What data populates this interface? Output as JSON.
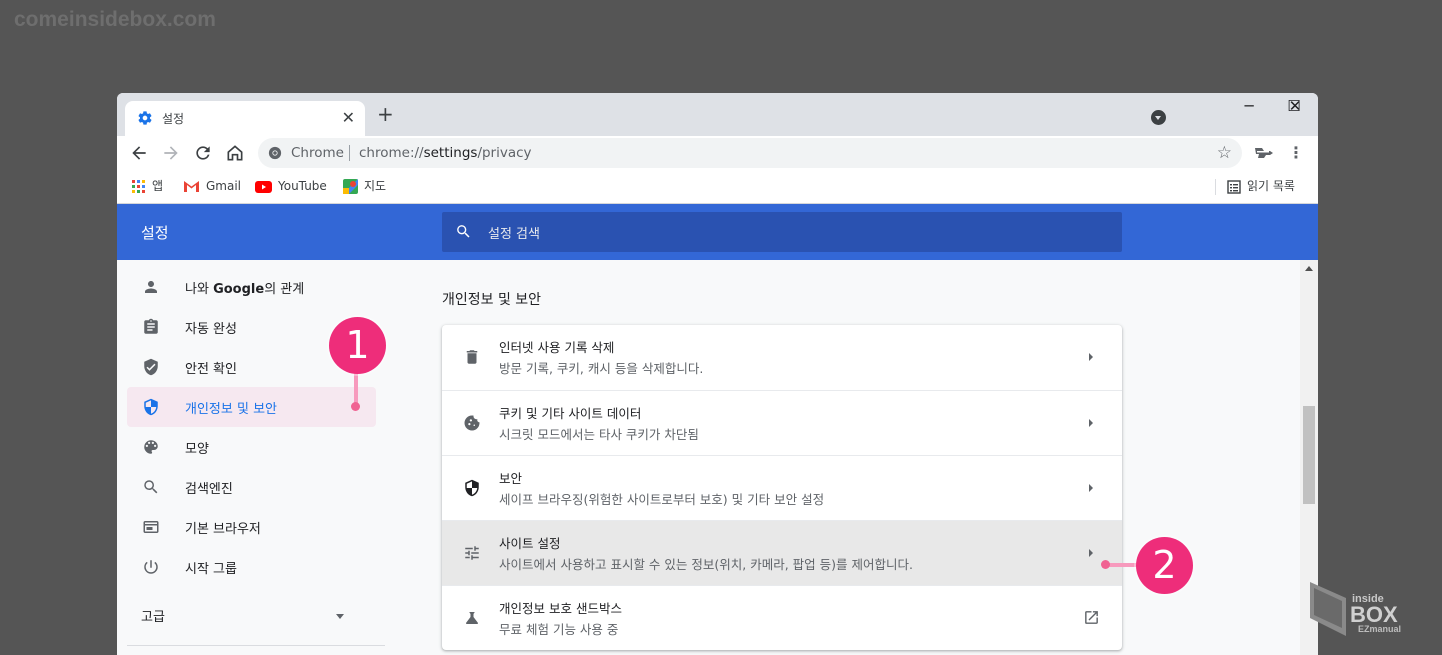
{
  "watermark": "comeinsidebox.com",
  "tab": {
    "title": "설정",
    "close": "✕"
  },
  "new_tab": "+",
  "window_controls": {
    "minimize": "─",
    "maximize": "☐",
    "close": "✕"
  },
  "omnibox": {
    "site": "Chrome",
    "url_prefix": "chrome://",
    "url_bold": "settings",
    "url_suffix": "/privacy"
  },
  "bookmarks": {
    "apps": "앱",
    "gmail": "Gmail",
    "youtube": "YouTube",
    "maps": "지도",
    "reading_list": "읽기 목록"
  },
  "settings": {
    "title": "설정",
    "search_placeholder": "설정 검색"
  },
  "sidebar": {
    "items": [
      {
        "label_pre": "나와 ",
        "label_bold": "Google",
        "label_post": "의 관계",
        "icon": "person-icon"
      },
      {
        "label": "자동 완성",
        "icon": "clipboard-icon"
      },
      {
        "label": "안전 확인",
        "icon": "shield-check-icon"
      },
      {
        "label": "개인정보 및 보안",
        "icon": "shield-half-icon"
      },
      {
        "label": "모양",
        "icon": "palette-icon"
      },
      {
        "label": "검색엔진",
        "icon": "search-icon"
      },
      {
        "label": "기본 브라우저",
        "icon": "browser-window-icon"
      },
      {
        "label": "시작 그룹",
        "icon": "power-icon"
      }
    ],
    "advanced": "고급"
  },
  "section": {
    "title": "개인정보 및 보안",
    "rows": [
      {
        "title": "인터넷 사용 기록 삭제",
        "subtitle": "방문 기록, 쿠키, 캐시 등을 삭제합니다.",
        "icon": "trash-icon"
      },
      {
        "title": "쿠키 및 기타 사이트 데이터",
        "subtitle": "시크릿 모드에서는 타사 쿠키가 차단됨",
        "icon": "cookie-icon"
      },
      {
        "title": "보안",
        "subtitle": "세이프 브라우징(위험한 사이트로부터 보호) 및 기타 보안 설정",
        "icon": "security-shield-icon"
      },
      {
        "title": "사이트 설정",
        "subtitle": "사이트에서 사용하고 표시할 수 있는 정보(위치, 카메라, 팝업 등)를 제어합니다.",
        "icon": "tune-icon"
      },
      {
        "title": "개인정보 보호 샌드박스",
        "subtitle": "무료 체험 기능 사용 중",
        "icon": "flask-icon"
      }
    ]
  },
  "annotations": {
    "step1": "1",
    "step2": "2"
  },
  "colors": {
    "header": "#3367d6",
    "search": "#2a52b1",
    "active": "#1a73e8",
    "badge": "#ee2d7a"
  },
  "logo": {
    "line1": "inside",
    "line2": "BOX",
    "line3": "EZmanual"
  }
}
